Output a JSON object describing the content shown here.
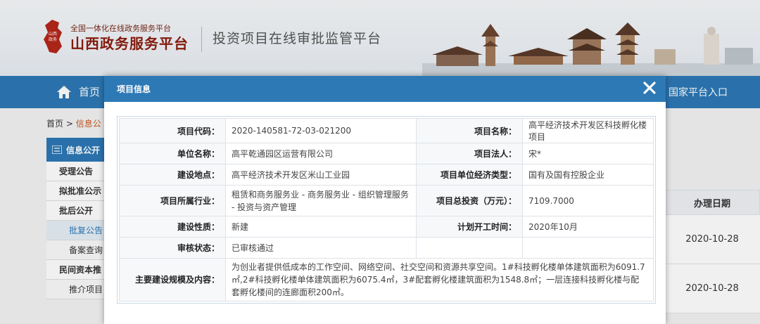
{
  "header": {
    "slogan": "全国一体化在线政务服务平台",
    "brand": "山西政务服务平台",
    "subtitle": "投资项目在线审批监管平台",
    "logo_text": "山西政务"
  },
  "nav": {
    "home_label": "首页",
    "right_link": "国家平台入口"
  },
  "breadcrumb": {
    "home": "首页",
    "separator": ">",
    "current": "信息公"
  },
  "sidebar": {
    "head_label": "信息公开",
    "items": [
      {
        "label": "受理公告",
        "type": "item"
      },
      {
        "label": "拟批准公示",
        "type": "item"
      },
      {
        "label": "批后公开",
        "type": "item"
      },
      {
        "label": "批复公告",
        "type": "sub",
        "active": true
      },
      {
        "label": "备案查询",
        "type": "sub"
      },
      {
        "label": "民间资本推",
        "type": "item"
      },
      {
        "label": "推介项目",
        "type": "sub"
      }
    ]
  },
  "background_table": {
    "header": "办理日期",
    "dates": [
      "2020-10-28",
      "2020-10-28"
    ]
  },
  "modal": {
    "title": "项目信息",
    "close_icon": "close-icon",
    "rows": {
      "code_label": "项目代码：",
      "code_value": "2020-140581-72-03-021200",
      "name_label": "项目名称：",
      "name_value": "高平经济技术开发区科技孵化楼项目",
      "unit_label": "单位名称：",
      "unit_value": "高平乾通园区运营有限公司",
      "legal_label": "项目法人：",
      "legal_value": "宋*",
      "site_label": "建设地点：",
      "site_value": "高平经济技术开发区米山工业园",
      "econ_label": "项目单位经济类型：",
      "econ_value": "国有及国有控股企业",
      "industry_label": "项目所属行业：",
      "industry_value": "租赁和商务服务业 - 商务服务业 - 组织管理服务 - 投资与资产管理",
      "invest_label": "项目总投资（万元）：",
      "invest_value": "7109.7000",
      "nature_label": "建设性质：",
      "nature_value": "新建",
      "start_label": "计划开工时间：",
      "start_value": "2020年10月",
      "status_label": "审核状态：",
      "status_value": "已审核通过",
      "scale_label": "主要建设规模及内容：",
      "scale_value": "为创业者提供低成本的工作空间、网络空间、社交空间和资源共享空间。1#科技孵化楼单体建筑面积为6091.7㎡,2#科技孵化楼单体建筑面积为6075.4㎡，3#配套孵化楼建筑面积为1548.8㎡；一层连接科技孵化楼与配套孵化楼间的连廊面积200㎡。"
    }
  },
  "colors": {
    "nav_blue": "#2d79b6",
    "brand_red": "#8b1c0e",
    "breadcrumb_active": "#c8561b"
  }
}
